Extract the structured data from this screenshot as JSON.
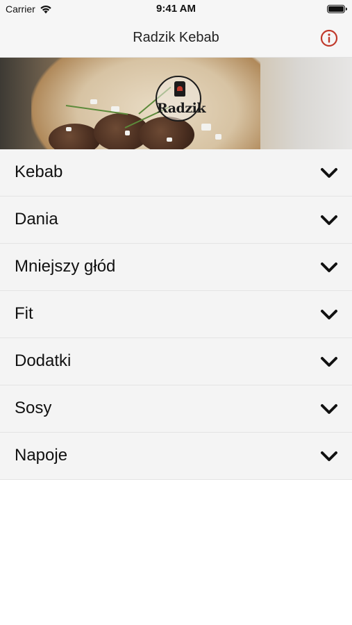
{
  "status_bar": {
    "carrier": "Carrier",
    "time": "9:41 AM",
    "icons": [
      "wifi-icon",
      "battery-icon"
    ]
  },
  "nav": {
    "title": "Radzik Kebab",
    "info_icon": "info-icon",
    "accent_color": "#c0392b"
  },
  "hero": {
    "logo_text": "Radzik"
  },
  "menu": {
    "chevron_icon": "chevron-down-icon",
    "items": [
      {
        "label": "Kebab"
      },
      {
        "label": "Dania"
      },
      {
        "label": "Mniejszy głód"
      },
      {
        "label": "Fit"
      },
      {
        "label": "Dodatki"
      },
      {
        "label": "Sosy"
      },
      {
        "label": "Napoje"
      }
    ]
  }
}
